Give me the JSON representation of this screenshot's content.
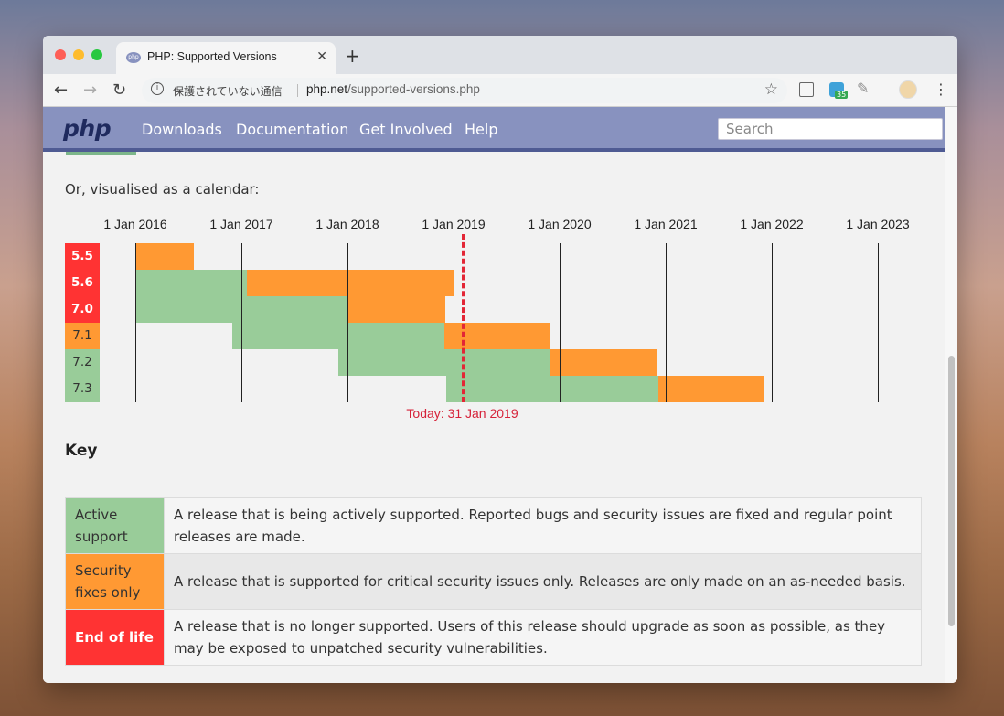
{
  "browser": {
    "tab_title": "PHP: Supported Versions",
    "tab_favicon_text": "php",
    "new_tab_symbol": "+",
    "url_warning": "保護されていない通信",
    "url_host": "php.net",
    "url_path": "/supported-versions.php",
    "extension_badge": "35"
  },
  "site": {
    "logo": "php",
    "nav": [
      "Downloads",
      "Documentation",
      "Get Involved",
      "Help"
    ],
    "search_placeholder": "Search"
  },
  "intro_text": "Or, visualised as a calendar:",
  "colors": {
    "active": "#9c9",
    "security": "#f93",
    "eol": "#f33",
    "today": "#e32636"
  },
  "chart_data": {
    "type": "gantt",
    "x_ticks": [
      "1 Jan 2016",
      "1 Jan 2017",
      "1 Jan 2018",
      "1 Jan 2019",
      "1 Jan 2020",
      "1 Jan 2021",
      "1 Jan 2022",
      "1 Jan 2023"
    ],
    "x_range": [
      "2015-09-01",
      "2023-03-01"
    ],
    "today": {
      "date": "2019-01-31",
      "label": "Today: 31 Jan 2019"
    },
    "rows": [
      {
        "version": "5.5",
        "status": "eol",
        "active": null,
        "security": [
          "2016-01-01",
          "2016-07-21"
        ]
      },
      {
        "version": "5.6",
        "status": "eol",
        "active": [
          "2016-01-01",
          "2017-01-19"
        ],
        "security": [
          "2017-01-19",
          "2018-12-31"
        ]
      },
      {
        "version": "7.0",
        "status": "eol",
        "active": [
          "2016-01-01",
          "2018-01-04"
        ],
        "security": [
          "2018-01-04",
          "2018-12-03"
        ]
      },
      {
        "version": "7.1",
        "status": "security",
        "active": [
          "2016-12-01",
          "2018-12-01"
        ],
        "security": [
          "2018-12-01",
          "2019-12-01"
        ]
      },
      {
        "version": "7.2",
        "status": "active",
        "active": [
          "2017-11-30",
          "2019-11-30"
        ],
        "security": [
          "2019-11-30",
          "2020-11-30"
        ]
      },
      {
        "version": "7.3",
        "status": "active",
        "active": [
          "2018-12-06",
          "2020-12-06"
        ],
        "security": [
          "2020-12-06",
          "2021-12-06"
        ]
      }
    ]
  },
  "key": {
    "title": "Key",
    "rows": [
      {
        "name": "Active support",
        "status": "active",
        "description": "A release that is being actively supported. Reported bugs and security issues are fixed and regular point releases are made."
      },
      {
        "name": "Security fixes only",
        "status": "security",
        "description": "A release that is supported for critical security issues only. Releases are only made on an as-needed basis."
      },
      {
        "name": "End of life",
        "status": "eol",
        "description": "A release that is no longer supported. Users of this release should upgrade as soon as possible, as they may be exposed to unpatched security vulnerabilities."
      }
    ]
  }
}
